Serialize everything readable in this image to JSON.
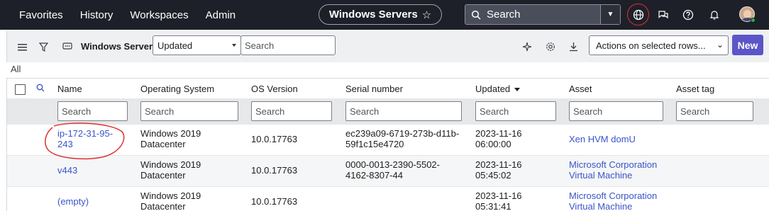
{
  "topbar": {
    "nav": [
      "Favorites",
      "History",
      "Workspaces",
      "Admin"
    ],
    "title": "Windows Servers",
    "search_placeholder": "Search",
    "icons": [
      "globe-icon",
      "chat-icon",
      "help-icon",
      "bell-icon",
      "avatar"
    ]
  },
  "toolbar": {
    "title": "Windows Servers",
    "field_select": "Updated",
    "search_placeholder": "Search",
    "actions_select": "Actions on selected rows...",
    "new_label": "New"
  },
  "breadcrumb": "All",
  "table": {
    "columns": [
      "Name",
      "Operating System",
      "OS Version",
      "Serial number",
      "Updated",
      "Asset",
      "Asset tag"
    ],
    "filter_placeholder": "Search",
    "rows": [
      {
        "name": "ip-172-31-95-243",
        "name_lines": [
          "ip-172-31-95-",
          "243"
        ],
        "os": [
          "Windows 2019",
          "Datacenter"
        ],
        "os_version": "10.0.17763",
        "serial": [
          "ec239a09-6719-273b-d11b-",
          "59f1c15e4720"
        ],
        "updated": [
          "2023-11-16",
          "06:00:00"
        ],
        "asset": [
          "Xen HVM domU"
        ],
        "asset_tag": ""
      },
      {
        "name": "v443",
        "name_lines": [
          "v443"
        ],
        "os": [
          "Windows 2019",
          "Datacenter"
        ],
        "os_version": "10.0.17763",
        "serial": [
          "0000-0013-2390-5502-",
          "4162-8307-44"
        ],
        "updated": [
          "2023-11-16",
          "05:45:02"
        ],
        "asset": [
          "Microsoft Corporation",
          "Virtual Machine"
        ],
        "asset_tag": ""
      },
      {
        "name": "(empty)",
        "name_lines": [
          "(empty)"
        ],
        "os": [
          "Windows 2019",
          "Datacenter"
        ],
        "os_version": "10.0.17763",
        "serial": [
          "",
          ""
        ],
        "updated": [
          "2023-11-16",
          "05:31:41"
        ],
        "asset": [
          "Microsoft Corporation",
          "Virtual Machine"
        ],
        "asset_tag": ""
      }
    ]
  },
  "colors": {
    "topbar": "#1e2029",
    "link": "#3b55c8",
    "new_button": "#5b55c8",
    "annotation": "#e03030"
  }
}
